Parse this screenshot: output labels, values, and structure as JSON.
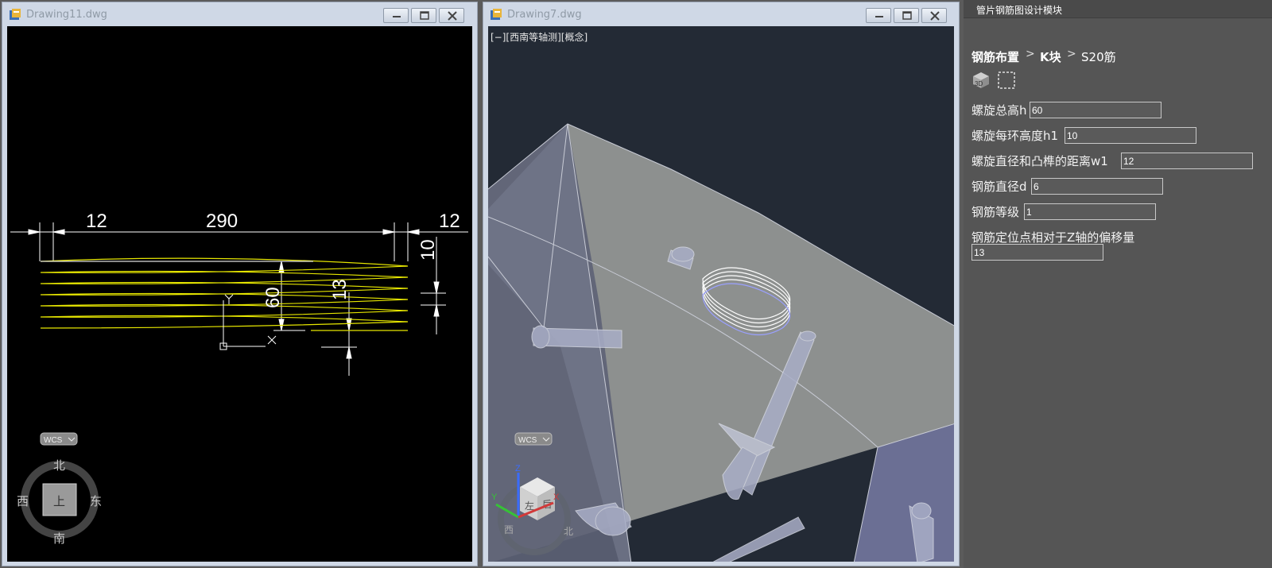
{
  "windows": [
    {
      "title": "Drawing11.dwg"
    },
    {
      "title": "Drawing7.dwg",
      "view_label": "[−][西南等轴测][概念]"
    }
  ],
  "drawing2d": {
    "dims": {
      "left": "12",
      "middle": "290",
      "right": "12",
      "h60": "60",
      "h13": "13",
      "h10": "10"
    },
    "ucs": {
      "x": "X",
      "y": "Y"
    },
    "wcs_label": "WCS",
    "compass": {
      "north": "北",
      "south": "南",
      "west": "西",
      "east": "东",
      "center": "上"
    }
  },
  "model3d": {
    "wcs_label": "WCS",
    "viewcube": {
      "face_front": "左",
      "face_right": "后",
      "west": "西",
      "north": "北"
    },
    "axes": {
      "x": "X",
      "y": "Y",
      "z": "Z"
    }
  },
  "panel": {
    "title": "管片钢筋图设计模块",
    "breadcrumb": [
      "钢筋布置",
      "K块",
      "S20筋"
    ],
    "fields": [
      {
        "label": "螺旋总高h",
        "value": "60"
      },
      {
        "label": "螺旋每环高度h1",
        "value": "10"
      },
      {
        "label": "螺旋直径和凸榫的距离w1",
        "value": "12"
      },
      {
        "label": "钢筋直径d",
        "value": "6"
      },
      {
        "label": "钢筋等级",
        "value": "1"
      },
      {
        "label": "钢筋定位点相对于Z轴的偏移量",
        "value": "13"
      }
    ]
  },
  "icons": [
    "dwg-file-icon",
    "minimize-icon",
    "restore-icon",
    "close-icon",
    "cube-3d-icon",
    "dashed-frame-icon"
  ],
  "colors": {
    "helix_2d": "#e6e600",
    "panel_bg": "#555555",
    "cad_bg": "#000000",
    "model_bg": "#232a35"
  }
}
